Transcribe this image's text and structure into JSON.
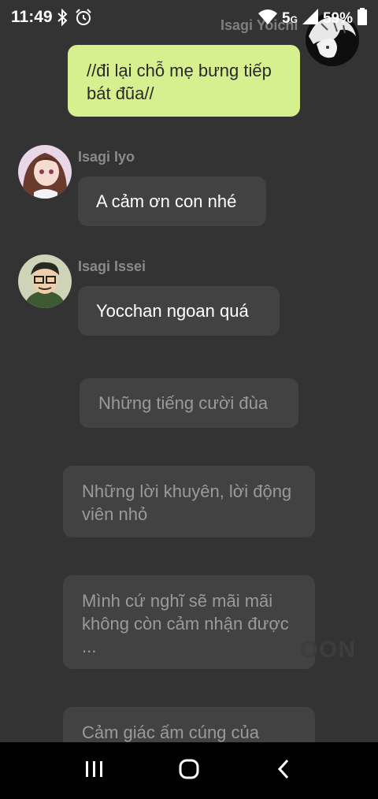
{
  "status_bar": {
    "time": "11:49",
    "network": "5",
    "network_suffix": "G",
    "battery": "59%"
  },
  "header": {
    "self_name": "Isagi Yoichi"
  },
  "messages": [
    {
      "sender": "",
      "text": "//đi lại chỗ mẹ bưng tiếp bát đũa//"
    },
    {
      "sender": "Isagi Iyo",
      "text": "A cảm ơn con nhé"
    },
    {
      "sender": "Isagi Issei",
      "text": "Yocchan ngoan quá"
    },
    {
      "sender": "",
      "text": "Những tiếng cười đùa"
    },
    {
      "sender": "",
      "text": "Những lời khuyên, lời động viên nhỏ"
    },
    {
      "sender": "",
      "text": "Mình cứ nghĩ sẽ mãi mãi không còn cảm nhận được ..."
    },
    {
      "sender": "",
      "text": "Cảm giác ấm cúng của"
    }
  ],
  "watermark": "OON",
  "colors": {
    "background": "#333333",
    "my_bubble": "#d6f08f",
    "other_bubble": "#424242",
    "nav_bar": "#000000"
  },
  "icons": {
    "status_left": [
      "bluetooth-icon",
      "alarm-icon"
    ],
    "status_right": [
      "wifi-icon",
      "signal-icon",
      "battery-icon"
    ],
    "nav": [
      "recent-apps-icon",
      "home-icon",
      "back-icon"
    ]
  }
}
